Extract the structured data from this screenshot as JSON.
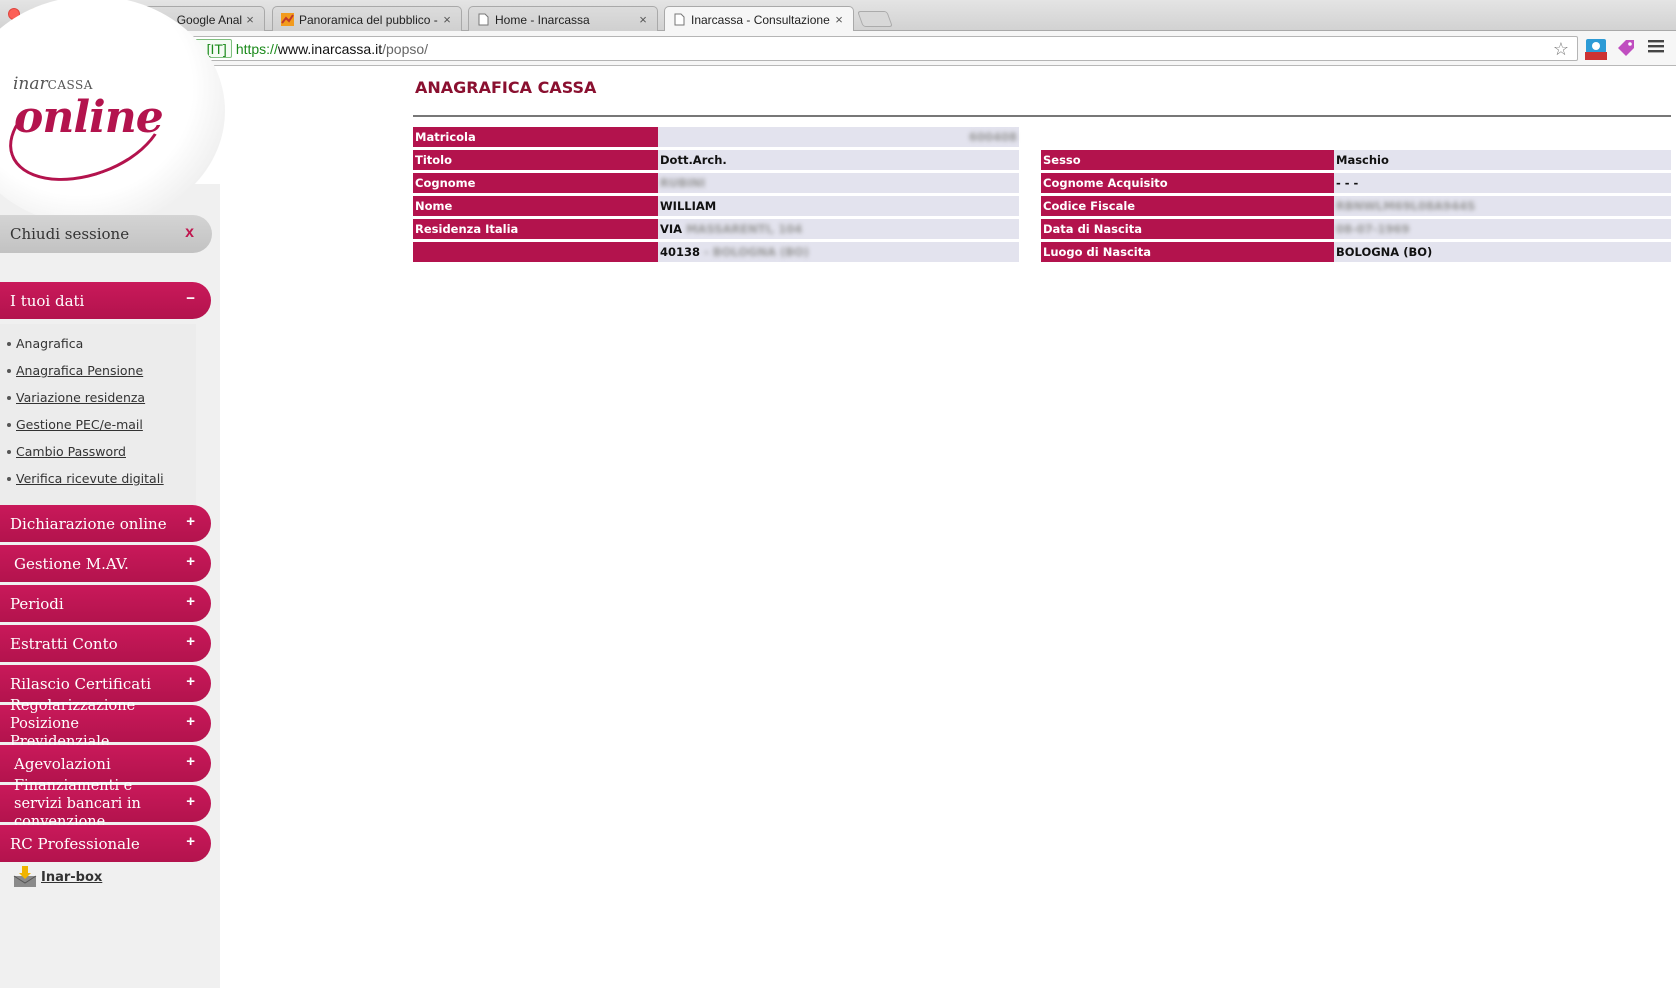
{
  "browser": {
    "tabs": [
      {
        "title": "Panoramica - Google Analy",
        "icon": "analytics-icon"
      },
      {
        "title": "Panoramica del pubblico -",
        "icon": "analytics-icon"
      },
      {
        "title": "Home - Inarcassa",
        "icon": "page-icon"
      },
      {
        "title": "Inarcassa - Consultazione d",
        "icon": "page-icon",
        "active": true
      }
    ],
    "address": {
      "ev_label": "Inarcassa [IT]",
      "scheme": "https://",
      "host": "www.inarcassa.it",
      "path": "/popso/"
    },
    "extension_badge": "error"
  },
  "logo": {
    "small_prefix": "inar",
    "small_caps": "CASSA",
    "main": "online"
  },
  "sidebar": {
    "logout_label": "Chiudi sessione",
    "logout_close": "x",
    "sections": [
      {
        "label": "I tuoi dati",
        "sign": "−"
      },
      {
        "label": "Dichiarazione online",
        "sign": "+"
      },
      {
        "label": "Gestione M.AV.",
        "sign": "+"
      },
      {
        "label": "Periodi",
        "sign": "+"
      },
      {
        "label": "Estratti Conto",
        "sign": "+"
      },
      {
        "label": "Rilascio Certificati",
        "sign": "+"
      },
      {
        "label": "Regolarizzazione Posizione Previdenziale",
        "sign": "+"
      },
      {
        "label": "Agevolazioni",
        "sign": "+"
      },
      {
        "label": "Finanziamenti e servizi bancari in convenzione",
        "sign": "+"
      },
      {
        "label": "RC Professionale",
        "sign": "+"
      }
    ],
    "submenu": [
      {
        "label": "Anagrafica"
      },
      {
        "label": "Anagrafica Pensione"
      },
      {
        "label": "Variazione residenza"
      },
      {
        "label": "Gestione PEC/e-mail"
      },
      {
        "label": "Cambio Password"
      },
      {
        "label": "Verifica ricevute digitali"
      }
    ],
    "inarbox_label": "Inar-box"
  },
  "main": {
    "title": "ANAGRAFICA CASSA",
    "left_table": [
      {
        "label": "Matricola",
        "value": "600408"
      },
      {
        "label": "Titolo",
        "value": "Dott.Arch."
      },
      {
        "label": "Cognome",
        "value": "RUBINI"
      },
      {
        "label": "Nome",
        "value": "WILLIAM"
      },
      {
        "label": "Residenza Italia",
        "value_prefix": "VIA",
        "value": "MASSARENTI, 104"
      },
      {
        "label": "",
        "value_prefix": "40138",
        "value": "- BOLOGNA (BO)"
      }
    ],
    "right_table": [
      {
        "label": "Sesso",
        "value": "Maschio"
      },
      {
        "label": "Cognome Acquisito",
        "value": "- - -"
      },
      {
        "label": "Codice Fiscale",
        "value": "RBNWLM69L08A944S"
      },
      {
        "label": "Data di Nascita",
        "value": "08-07-1969"
      },
      {
        "label": "Luogo di Nascita",
        "value": "BOLOGNA (BO)"
      }
    ]
  }
}
